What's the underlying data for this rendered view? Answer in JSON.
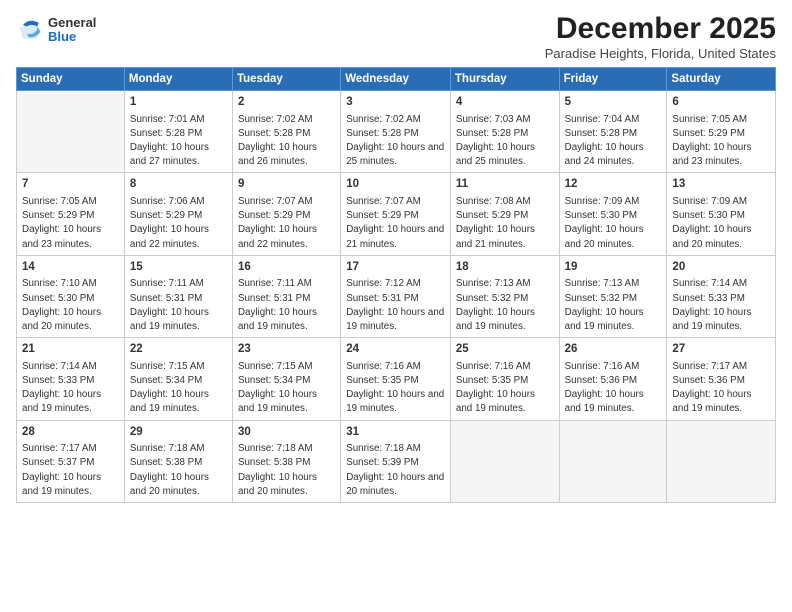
{
  "logo": {
    "general": "General",
    "blue": "Blue"
  },
  "header": {
    "month": "December 2025",
    "location": "Paradise Heights, Florida, United States"
  },
  "weekdays": [
    "Sunday",
    "Monday",
    "Tuesday",
    "Wednesday",
    "Thursday",
    "Friday",
    "Saturday"
  ],
  "weeks": [
    [
      {
        "day": "",
        "empty": true
      },
      {
        "day": "1",
        "sunrise": "7:01 AM",
        "sunset": "5:28 PM",
        "daylight": "10 hours and 27 minutes."
      },
      {
        "day": "2",
        "sunrise": "7:02 AM",
        "sunset": "5:28 PM",
        "daylight": "10 hours and 26 minutes."
      },
      {
        "day": "3",
        "sunrise": "7:02 AM",
        "sunset": "5:28 PM",
        "daylight": "10 hours and 25 minutes."
      },
      {
        "day": "4",
        "sunrise": "7:03 AM",
        "sunset": "5:28 PM",
        "daylight": "10 hours and 25 minutes."
      },
      {
        "day": "5",
        "sunrise": "7:04 AM",
        "sunset": "5:28 PM",
        "daylight": "10 hours and 24 minutes."
      },
      {
        "day": "6",
        "sunrise": "7:05 AM",
        "sunset": "5:29 PM",
        "daylight": "10 hours and 23 minutes."
      }
    ],
    [
      {
        "day": "7",
        "sunrise": "7:05 AM",
        "sunset": "5:29 PM",
        "daylight": "10 hours and 23 minutes."
      },
      {
        "day": "8",
        "sunrise": "7:06 AM",
        "sunset": "5:29 PM",
        "daylight": "10 hours and 22 minutes."
      },
      {
        "day": "9",
        "sunrise": "7:07 AM",
        "sunset": "5:29 PM",
        "daylight": "10 hours and 22 minutes."
      },
      {
        "day": "10",
        "sunrise": "7:07 AM",
        "sunset": "5:29 PM",
        "daylight": "10 hours and 21 minutes."
      },
      {
        "day": "11",
        "sunrise": "7:08 AM",
        "sunset": "5:29 PM",
        "daylight": "10 hours and 21 minutes."
      },
      {
        "day": "12",
        "sunrise": "7:09 AM",
        "sunset": "5:30 PM",
        "daylight": "10 hours and 20 minutes."
      },
      {
        "day": "13",
        "sunrise": "7:09 AM",
        "sunset": "5:30 PM",
        "daylight": "10 hours and 20 minutes."
      }
    ],
    [
      {
        "day": "14",
        "sunrise": "7:10 AM",
        "sunset": "5:30 PM",
        "daylight": "10 hours and 20 minutes."
      },
      {
        "day": "15",
        "sunrise": "7:11 AM",
        "sunset": "5:31 PM",
        "daylight": "10 hours and 19 minutes."
      },
      {
        "day": "16",
        "sunrise": "7:11 AM",
        "sunset": "5:31 PM",
        "daylight": "10 hours and 19 minutes."
      },
      {
        "day": "17",
        "sunrise": "7:12 AM",
        "sunset": "5:31 PM",
        "daylight": "10 hours and 19 minutes."
      },
      {
        "day": "18",
        "sunrise": "7:13 AM",
        "sunset": "5:32 PM",
        "daylight": "10 hours and 19 minutes."
      },
      {
        "day": "19",
        "sunrise": "7:13 AM",
        "sunset": "5:32 PM",
        "daylight": "10 hours and 19 minutes."
      },
      {
        "day": "20",
        "sunrise": "7:14 AM",
        "sunset": "5:33 PM",
        "daylight": "10 hours and 19 minutes."
      }
    ],
    [
      {
        "day": "21",
        "sunrise": "7:14 AM",
        "sunset": "5:33 PM",
        "daylight": "10 hours and 19 minutes."
      },
      {
        "day": "22",
        "sunrise": "7:15 AM",
        "sunset": "5:34 PM",
        "daylight": "10 hours and 19 minutes."
      },
      {
        "day": "23",
        "sunrise": "7:15 AM",
        "sunset": "5:34 PM",
        "daylight": "10 hours and 19 minutes."
      },
      {
        "day": "24",
        "sunrise": "7:16 AM",
        "sunset": "5:35 PM",
        "daylight": "10 hours and 19 minutes."
      },
      {
        "day": "25",
        "sunrise": "7:16 AM",
        "sunset": "5:35 PM",
        "daylight": "10 hours and 19 minutes."
      },
      {
        "day": "26",
        "sunrise": "7:16 AM",
        "sunset": "5:36 PM",
        "daylight": "10 hours and 19 minutes."
      },
      {
        "day": "27",
        "sunrise": "7:17 AM",
        "sunset": "5:36 PM",
        "daylight": "10 hours and 19 minutes."
      }
    ],
    [
      {
        "day": "28",
        "sunrise": "7:17 AM",
        "sunset": "5:37 PM",
        "daylight": "10 hours and 19 minutes."
      },
      {
        "day": "29",
        "sunrise": "7:18 AM",
        "sunset": "5:38 PM",
        "daylight": "10 hours and 20 minutes."
      },
      {
        "day": "30",
        "sunrise": "7:18 AM",
        "sunset": "5:38 PM",
        "daylight": "10 hours and 20 minutes."
      },
      {
        "day": "31",
        "sunrise": "7:18 AM",
        "sunset": "5:39 PM",
        "daylight": "10 hours and 20 minutes."
      },
      {
        "day": "",
        "empty": true
      },
      {
        "day": "",
        "empty": true
      },
      {
        "day": "",
        "empty": true
      }
    ]
  ]
}
